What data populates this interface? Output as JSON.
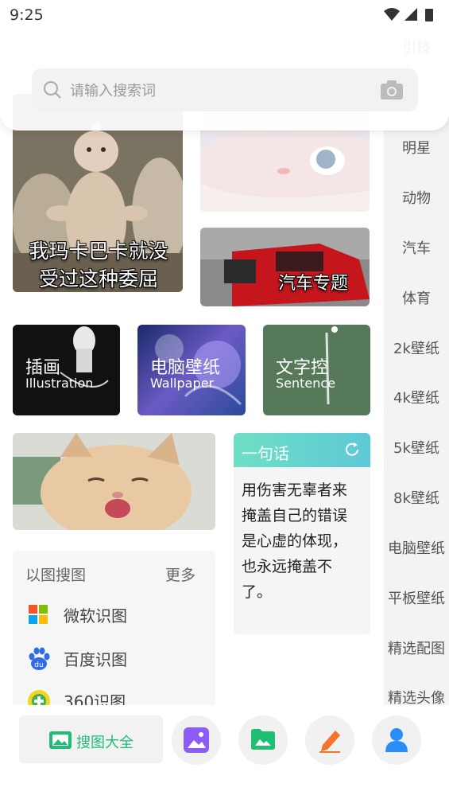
{
  "status_bar": {
    "time": "9:25"
  },
  "search": {
    "placeholder": "请输入搜索词"
  },
  "sidebar": {
    "items": [
      "引技",
      "",
      "明星",
      "动物",
      "汽车",
      "体育",
      "2k壁纸",
      "4k壁纸",
      "5k壁纸",
      "8k壁纸",
      "电脑壁纸",
      "平板壁纸",
      "精选配图",
      "精选头像"
    ]
  },
  "tiles": {
    "meme_caption_line1": "我玛卡巴卡就没",
    "meme_caption_line2": "受过这种委屈",
    "car_label": "汽车专题",
    "illustration": {
      "title": "插画",
      "subtitle": "Illustration"
    },
    "wallpaper": {
      "title": "电脑壁纸",
      "subtitle": "Wallpaper"
    },
    "sentence": {
      "title": "文字控",
      "subtitle": "Sentence"
    }
  },
  "quote_card": {
    "title": "一句话",
    "text": "用伤害无辜者来掩盖自己的错误是心虚的体现，也永远掩盖不了。"
  },
  "image_search": {
    "title": "以图搜图",
    "more": "更多",
    "items": [
      {
        "label": "微软识图",
        "icon": "microsoft-logo-icon"
      },
      {
        "label": "百度识图",
        "icon": "baidu-paw-icon"
      },
      {
        "label": "360识图",
        "icon": "360-logo-icon"
      }
    ]
  },
  "bottom_nav": {
    "main_label": "搜图大全",
    "colors": {
      "green": "#1fbf73",
      "purple": "#8b5cf6",
      "orange": "#f7722a",
      "blue": "#2a8cf7"
    }
  }
}
